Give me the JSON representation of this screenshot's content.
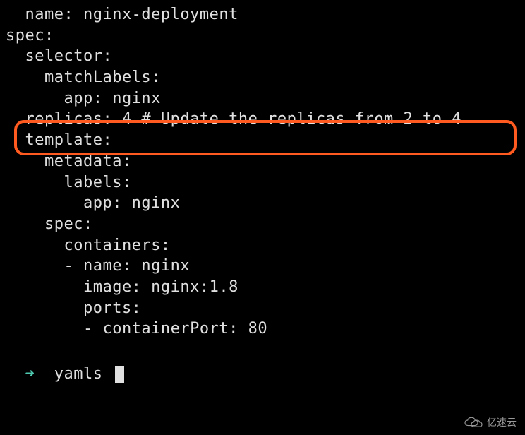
{
  "yaml": {
    "l1": "  name: nginx-deployment",
    "l2": "spec:",
    "l3": "  selector:",
    "l4": "    matchLabels:",
    "l5": "      app: nginx",
    "l6": "  replicas: 4 # Update the replicas from 2 to 4",
    "l7": "  template:",
    "l8": "    metadata:",
    "l9": "      labels:",
    "l10": "        app: nginx",
    "l11": "    spec:",
    "l12": "      containers:",
    "l13": "      - name: nginx",
    "l14": "        image: nginx:1.8",
    "l15": "        ports:",
    "l16": "        - containerPort: 80"
  },
  "prompt": {
    "arrow": "➜",
    "dir": "yamls"
  },
  "watermark": {
    "text": "亿速云"
  }
}
